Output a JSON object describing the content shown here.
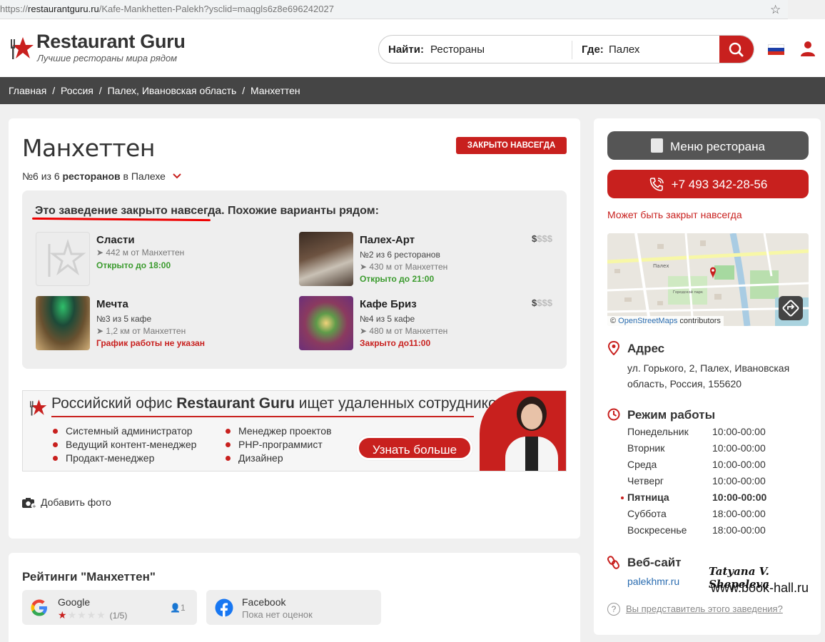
{
  "browser": {
    "url_prefix": "https://",
    "url_host": "restaurantguru.ru",
    "url_path": "/Kafe-Mankhetten-Palekh?ysclid=maqgls6z8e696242027"
  },
  "header": {
    "logo_title": "Restaurant Guru",
    "logo_subtitle": "Лучшие рестораны мира рядом",
    "search": {
      "find_label": "Найти:",
      "find_value": "Рестораны",
      "where_label": "Где:",
      "where_value": "Палех"
    }
  },
  "breadcrumbs": [
    "Главная",
    "/",
    "Россия",
    "/",
    "Палех, Ивановская область",
    "/",
    "Манхеттен"
  ],
  "main": {
    "title": "Манхеттен",
    "closed_badge": "ЗАКРЫТО НАВСЕГДА",
    "rank_prefix": "№6 из 6 ",
    "rank_bold": "ресторанов",
    "rank_suffix": " в Палехе",
    "similar_heading_main": "Это заведение закрыто навсегда.",
    "similar_heading_rest": " Похожие варианты рядом:",
    "similar": [
      {
        "name": "Сласти",
        "line1": "",
        "distance": "➤ 442 м от Манхеттен",
        "status": "Открыто до 18:00",
        "status_type": "open",
        "price": ""
      },
      {
        "name": "Палех-Арт",
        "line1": "№2 из 6 ресторанов",
        "distance": "➤ 430 м от Манхеттен",
        "status": "Открыто до 21:00",
        "status_type": "open",
        "price_bold": "$",
        "price_rest": "$$$"
      },
      {
        "name": "Мечта",
        "line1": "№3 из 5 кафе",
        "distance": "➤ 1,2 км от Манхеттен",
        "status": "График работы не указан",
        "status_type": "red",
        "price": ""
      },
      {
        "name": "Кафе Бриз",
        "line1": "№4 из 5 кафе",
        "distance": "➤ 480 м от Манхеттен",
        "status": "Закрыто до11:00",
        "status_type": "red",
        "price_bold": "$",
        "price_rest": "$$$"
      }
    ],
    "banner": {
      "title_pre": "Российский офис ",
      "title_bold": "Restaurant Guru",
      "title_post": " ищет удаленных сотрудников!",
      "col1": [
        "Системный администратор",
        "Ведущий контент-менеджер",
        "Продакт-менеджер"
      ],
      "col2": [
        "Менеджер проектов",
        "PHP-программист",
        "Дизайнер"
      ],
      "button": "Узнать больше"
    },
    "add_photo": "Добавить фото"
  },
  "ratings": {
    "title": "Рейтинги \"Манхеттен\"",
    "google": {
      "name": "Google",
      "score": "(1/5)",
      "stars": 1,
      "reviewers": "1"
    },
    "facebook": {
      "name": "Facebook",
      "sub": "Пока нет оценок"
    }
  },
  "sidebar": {
    "menu_button": "Меню ресторана",
    "phone": "+7 493 342-28-56",
    "may_closed": "Может быть закрыт навсегда",
    "map_attrib_prefix": "© ",
    "map_attrib_link": "OpenStreetMaps",
    "map_attrib_suffix": " contributors",
    "map_label_1": "Палех",
    "map_label_2": "Городской парк",
    "address_title": "Адрес",
    "address": "ул. Горького, 2, Палех, Ивановская область, Россия, 155620",
    "hours_title": "Режим работы",
    "hours": [
      {
        "day": "Понедельник",
        "time": "10:00-00:00",
        "today": false
      },
      {
        "day": "Вторник",
        "time": "10:00-00:00",
        "today": false
      },
      {
        "day": "Среда",
        "time": "10:00-00:00",
        "today": false
      },
      {
        "day": "Четверг",
        "time": "10:00-00:00",
        "today": false
      },
      {
        "day": "Пятница",
        "time": "10:00-00:00",
        "today": true
      },
      {
        "day": "Суббота",
        "time": "18:00-00:00",
        "today": false
      },
      {
        "day": "Воскресенье",
        "time": "18:00-00:00",
        "today": false
      }
    ],
    "website_title": "Веб-сайт",
    "website": "palekhmr.ru",
    "representative": "Вы представитель этого заведения?"
  },
  "watermark": {
    "line1": "Tatyana V. Shepeleva",
    "line2": "www.book-hall.ru"
  },
  "colors": {
    "brand_red": "#c8201e",
    "open_green": "#3b9b2e",
    "breadcrumb_bg": "#454545",
    "link_blue": "#2a6cb0"
  }
}
